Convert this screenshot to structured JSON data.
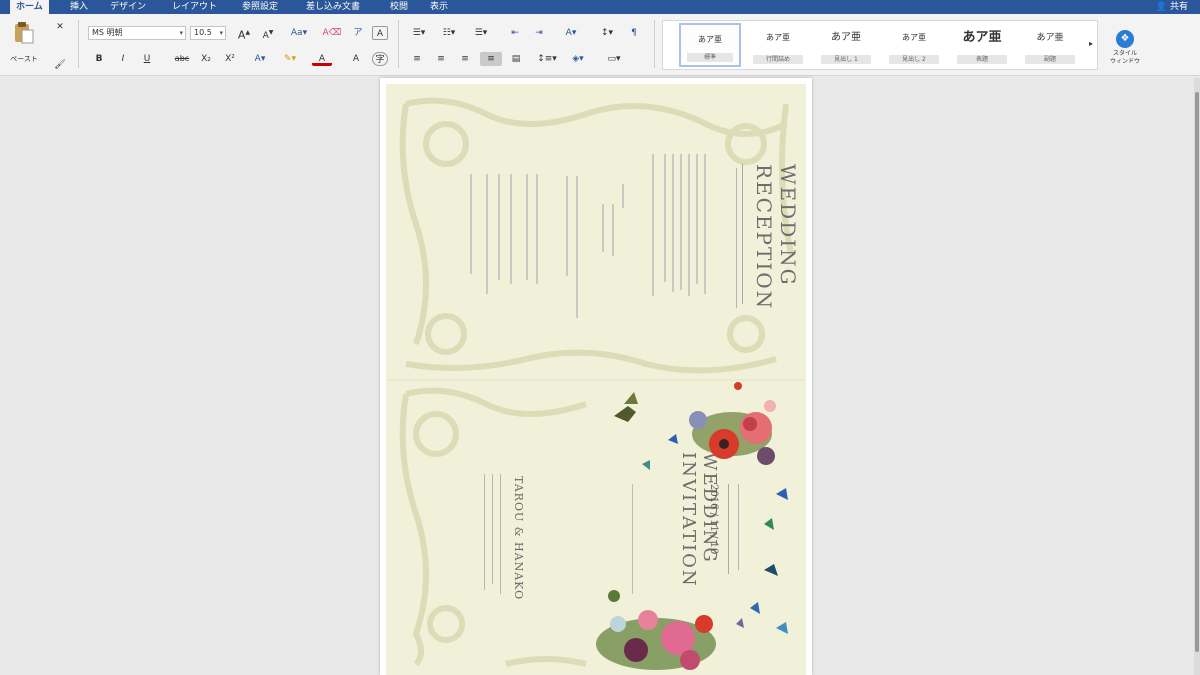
{
  "ribbon": {
    "tabs": [
      "ホーム",
      "挿入",
      "デザイン",
      "レイアウト",
      "参照設定",
      "差し込み文書",
      "校閲",
      "表示"
    ],
    "active_tab": "ホーム",
    "share_label": "共有",
    "paste_label": "ペースト",
    "font_name": "MS 明朝",
    "font_size": "10.5",
    "format_buttons": [
      "B",
      "I",
      "U",
      "abc",
      "X₂",
      "X²"
    ],
    "grow_font": "A",
    "shrink_font": "A",
    "style_sample": "あア亜",
    "style_sample_large": "あア亜",
    "styles_pane_label": "スタイル\nウィンドウ",
    "style_items": [
      "標準",
      "行間詰め",
      "見出し 1",
      "見出し 2",
      "表題",
      "副題"
    ]
  },
  "document": {
    "title_reception": "WEDDING RECEPTION",
    "title_invitation": "WEDDING INVITATION",
    "names": "TAROU & HANAKO",
    "date": "2016 / 11 / 10"
  },
  "colors": {
    "ribbon_blue": "#2b579a",
    "card_bg": "#f1f0d8",
    "flower_red": "#d83a2c"
  }
}
